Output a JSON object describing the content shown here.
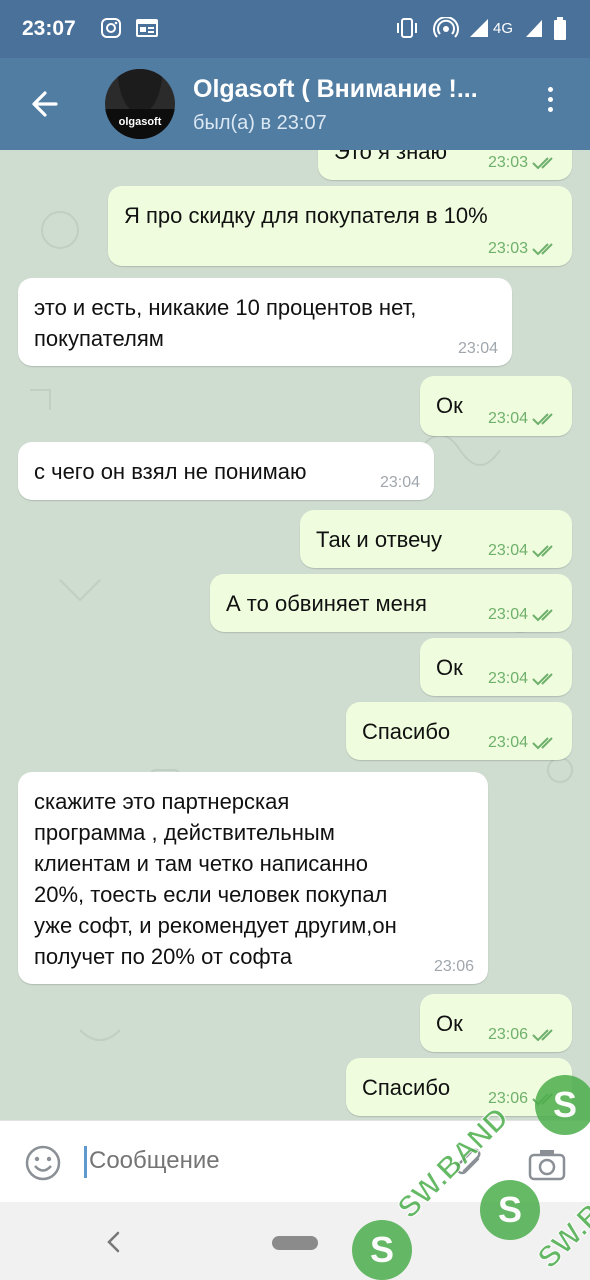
{
  "status_bar": {
    "time": "23:07",
    "network": "4G",
    "icons": [
      "instagram-icon",
      "news-icon",
      "vibrate-icon",
      "hotspot-icon",
      "signal-icon",
      "signal-icon",
      "battery-icon"
    ]
  },
  "header": {
    "title": "Olgasoft ( Внимание !...",
    "status": "был(а) в 23:07",
    "avatar_text": "olgasoft"
  },
  "messages": [
    {
      "dir": "out",
      "text": "Это я знаю",
      "time": "23:03",
      "read": true
    },
    {
      "dir": "out",
      "text": "Я про скидку для покупателя в 10%",
      "time": "23:03",
      "read": true
    },
    {
      "dir": "in",
      "lines": [
        "это и есть, никакие 10 процентов нет,",
        "покупателям"
      ],
      "time": "23:04"
    },
    {
      "dir": "out",
      "text": "Ок",
      "time": "23:04",
      "read": true
    },
    {
      "dir": "in",
      "text": "с чего он взял не понимаю",
      "time": "23:04"
    },
    {
      "dir": "out",
      "text": "Так и отвечу",
      "time": "23:04",
      "read": true
    },
    {
      "dir": "out",
      "text": "А то обвиняет меня",
      "time": "23:04",
      "read": true
    },
    {
      "dir": "out",
      "text": "Ок",
      "time": "23:04",
      "read": true
    },
    {
      "dir": "out",
      "text": "Спасибо",
      "time": "23:04",
      "read": true
    },
    {
      "dir": "in",
      "lines": [
        "скажите это партнерская",
        "программа , действительным",
        "клиентам и там четко написанно",
        "20%, тоесть если человек покупал",
        "уже софт, и рекомендует другим,он",
        "получет по 20% от софта"
      ],
      "time": "23:06"
    },
    {
      "dir": "out",
      "text": "Ок",
      "time": "23:06",
      "read": true
    },
    {
      "dir": "out",
      "text": "Спасибо",
      "time": "23:06",
      "read": true
    }
  ],
  "input": {
    "placeholder": "Сообщение"
  },
  "watermark": {
    "text": "SW.BAND"
  },
  "colors": {
    "header": "#517da2",
    "status_bar": "#4a7199",
    "outgoing_bubble": "#effdde",
    "incoming_bubble": "#ffffff",
    "read_check": "#6fb06c",
    "watermark": "#4cae4c"
  }
}
